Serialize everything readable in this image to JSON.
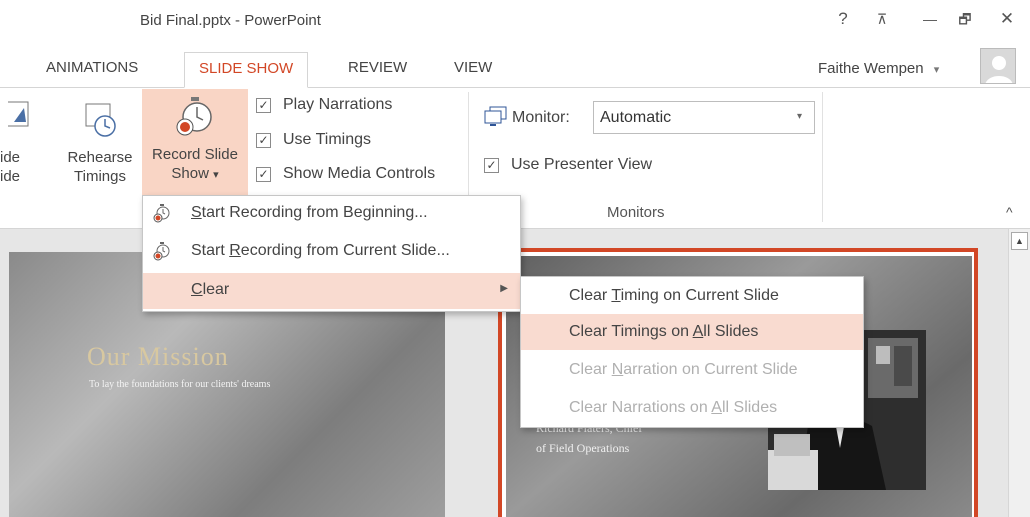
{
  "window": {
    "title": "Bid Final.pptx - PowerPoint",
    "help": "?",
    "ribbon_options": "⊼",
    "minimize": "—",
    "restore": "🗗",
    "close": "✕"
  },
  "tabs": [
    {
      "label": "ANIMATIONS",
      "active": false
    },
    {
      "label": "SLIDE SHOW",
      "active": true
    },
    {
      "label": "REVIEW",
      "active": false
    },
    {
      "label": "VIEW",
      "active": false
    }
  ],
  "user": {
    "name": "Faithe Wempen",
    "dropdown": "▾"
  },
  "ribbon": {
    "hide_slide": {
      "line1": "ide",
      "line2": "ide"
    },
    "rehearse_timings": {
      "line1": "Rehearse",
      "line2": "Timings"
    },
    "record_slide_show": {
      "line1": "Record Slide",
      "line2": "Show",
      "arrow": "▾"
    },
    "checkboxes": [
      {
        "label": "Play Narrations",
        "checked": true
      },
      {
        "label": "Use Timings",
        "checked": true
      },
      {
        "label": "Show Media Controls",
        "checked": true
      }
    ],
    "monitors": {
      "monitor_label": "Monitor:",
      "monitor_value": "Automatic",
      "presenter_view_label": "Use Presenter View",
      "presenter_view_checked": true,
      "group_label": "Monitors"
    },
    "checkmark": "✓",
    "collapse": "^"
  },
  "record_menu": {
    "items": [
      {
        "pre": "",
        "accel": "S",
        "post": "tart Recording from Beginning...",
        "has_icon": true,
        "submenu": false
      },
      {
        "pre": "Start ",
        "accel": "R",
        "post": "ecording from Current Slide...",
        "has_icon": true,
        "submenu": false
      },
      {
        "pre": "",
        "accel": "C",
        "post": "lear",
        "has_icon": false,
        "submenu": true
      }
    ],
    "submenu_arrow": "▶"
  },
  "clear_submenu": {
    "items": [
      {
        "pre": "Clear ",
        "accel": "T",
        "post": "iming on Current Slide",
        "enabled": true,
        "highlighted": false
      },
      {
        "pre": "Clear Timings on ",
        "accel": "A",
        "post": "ll Slides",
        "enabled": true,
        "highlighted": true
      },
      {
        "pre": "Clear ",
        "accel": "N",
        "post": "arration on Current Slide",
        "enabled": false,
        "highlighted": false
      },
      {
        "pre": "Clear Narrations on ",
        "accel": "A",
        "post": "ll Slides",
        "enabled": false,
        "highlighted": false
      }
    ]
  },
  "slides": {
    "left": {
      "title": "Our Mission",
      "subtitle": "To lay the foundations for our clients' dreams"
    },
    "right": {
      "text_line1": "Richard Flaters, Chief",
      "text_line2": "of Field Operations"
    }
  },
  "scroll_up": "▲",
  "colors": {
    "accent": "#d24726",
    "highlight": "#f9dbd0",
    "record_button": "#f9d5c5"
  }
}
